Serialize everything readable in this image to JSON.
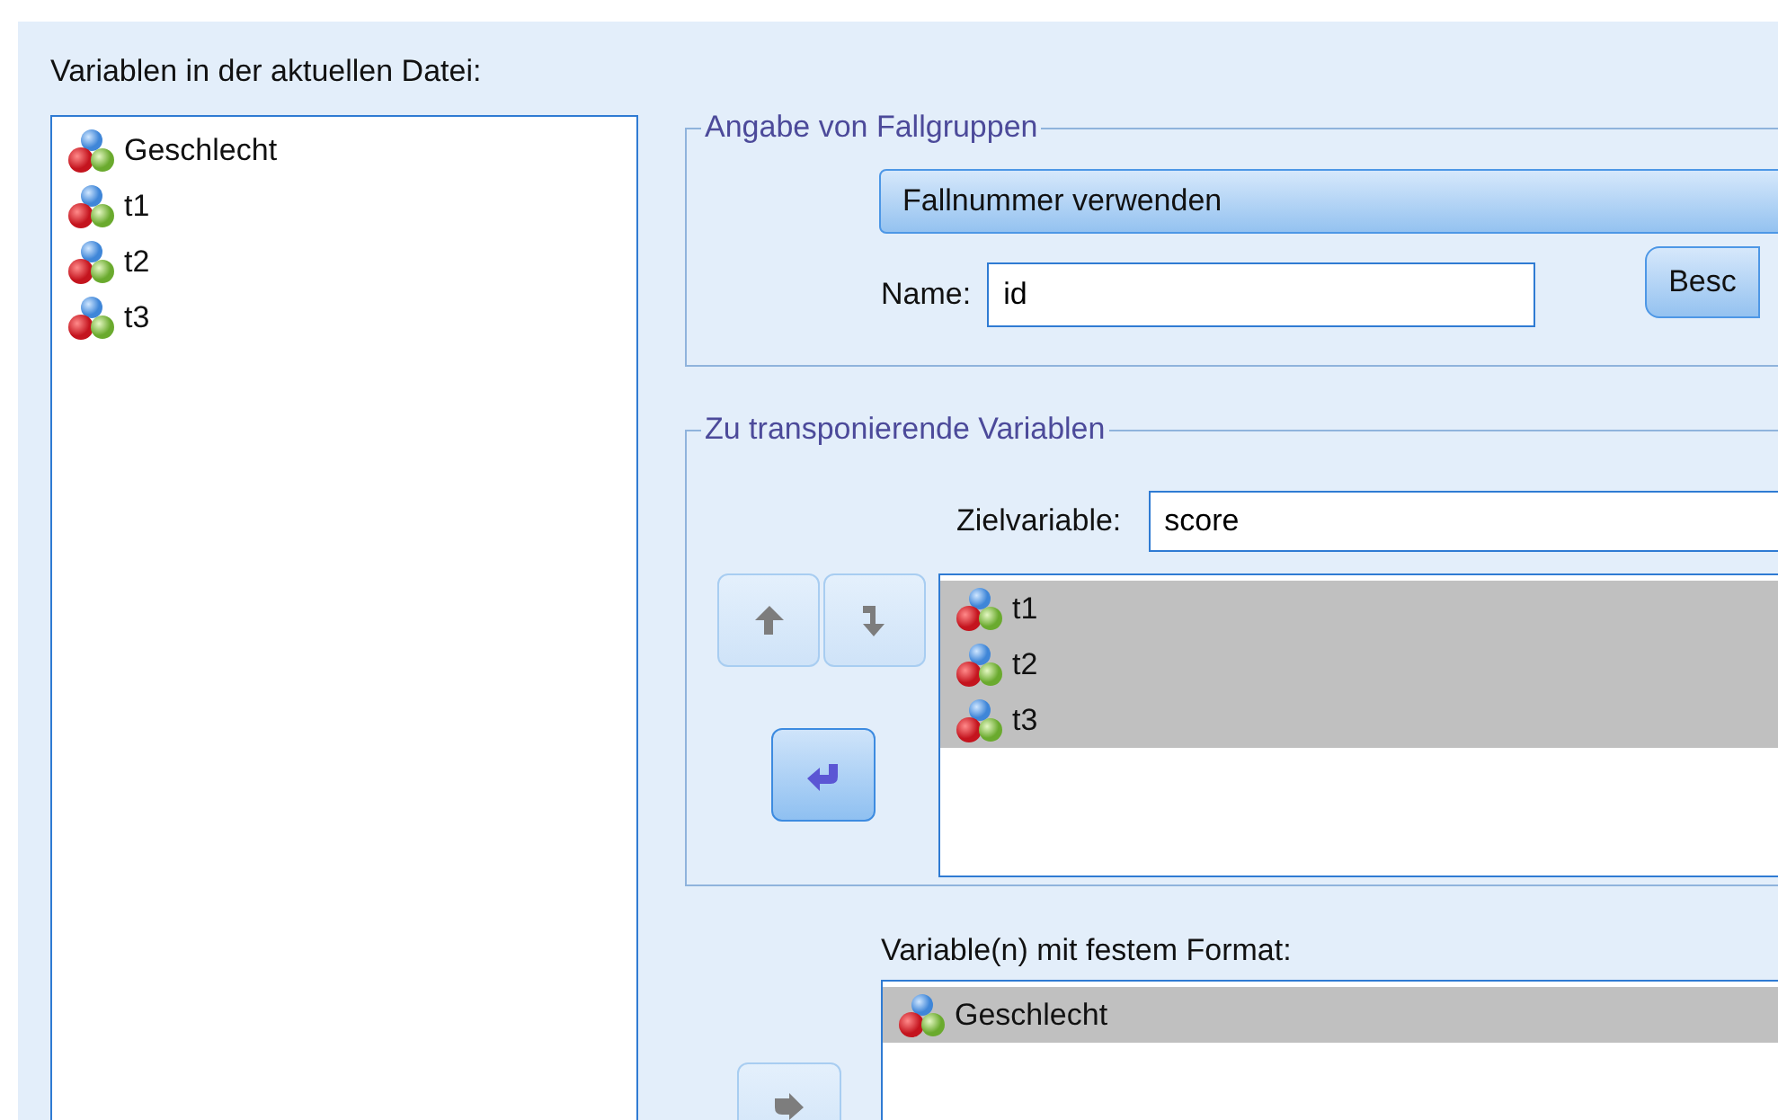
{
  "source_list": {
    "label": "Variablen in der aktuellen Datei:",
    "items": [
      {
        "name": "Geschlecht",
        "selected": false
      },
      {
        "name": "t1",
        "selected": false
      },
      {
        "name": "t2",
        "selected": false
      },
      {
        "name": "t3",
        "selected": false
      }
    ]
  },
  "case_group": {
    "legend": "Angabe von Fallgruppen",
    "dropdown": "Fallnummer verwenden",
    "name_label": "Name:",
    "name_value": "id",
    "button": "Besc"
  },
  "transpose_group": {
    "legend": "Zu transponierende Variablen",
    "target_label": "Zielvariable:",
    "target_value": "score",
    "move_buttons": [
      {
        "kind": "up",
        "disabled": true
      },
      {
        "kind": "down",
        "disabled": true
      }
    ],
    "transfer_button": {
      "kind": "left",
      "disabled": false
    },
    "items": [
      {
        "name": "t1",
        "selected": true
      },
      {
        "name": "t2",
        "selected": true
      },
      {
        "name": "t3",
        "selected": true
      }
    ]
  },
  "fixed_list": {
    "label": "Variable(n) mit festem Format:",
    "transfer_button": {
      "kind": "right",
      "disabled": true
    },
    "items": [
      {
        "name": "Geschlecht",
        "selected": true
      }
    ]
  }
}
